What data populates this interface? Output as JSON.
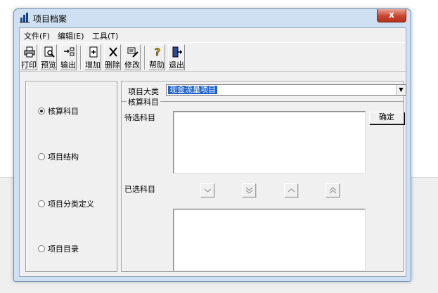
{
  "window": {
    "title": "项目档案",
    "close_symbol": "x"
  },
  "menu": {
    "file": "文件(F)",
    "edit": "编辑(E)",
    "tools": "工具(T)"
  },
  "toolbar": {
    "print": "打印",
    "preview": "预览",
    "export": "输出",
    "add": "增加",
    "delete": "删除",
    "modify": "修改",
    "help": "帮助",
    "exit": "退出"
  },
  "left_options": [
    {
      "label": "核算科目",
      "selected": true
    },
    {
      "label": "项目结构",
      "selected": false
    },
    {
      "label": "项目分类定义",
      "selected": false
    },
    {
      "label": "项目目录",
      "selected": false
    }
  ],
  "main": {
    "category_label": "项目大类",
    "category_value": "现金流量项目",
    "group_title": "核算科目",
    "pending_label": "待选科目",
    "selected_label": "已选科目",
    "confirm": "确定"
  },
  "icons": {
    "app": "chart-icon",
    "print": "printer-icon",
    "preview": "preview-icon",
    "export": "export-icon",
    "add": "add-doc-icon",
    "delete": "delete-icon",
    "modify": "edit-icon",
    "help": "help-icon",
    "exit": "exit-icon"
  },
  "colors": {
    "title_bg": "#cfe0f2",
    "selection": "#1e62c9",
    "close": "#c8452f"
  }
}
